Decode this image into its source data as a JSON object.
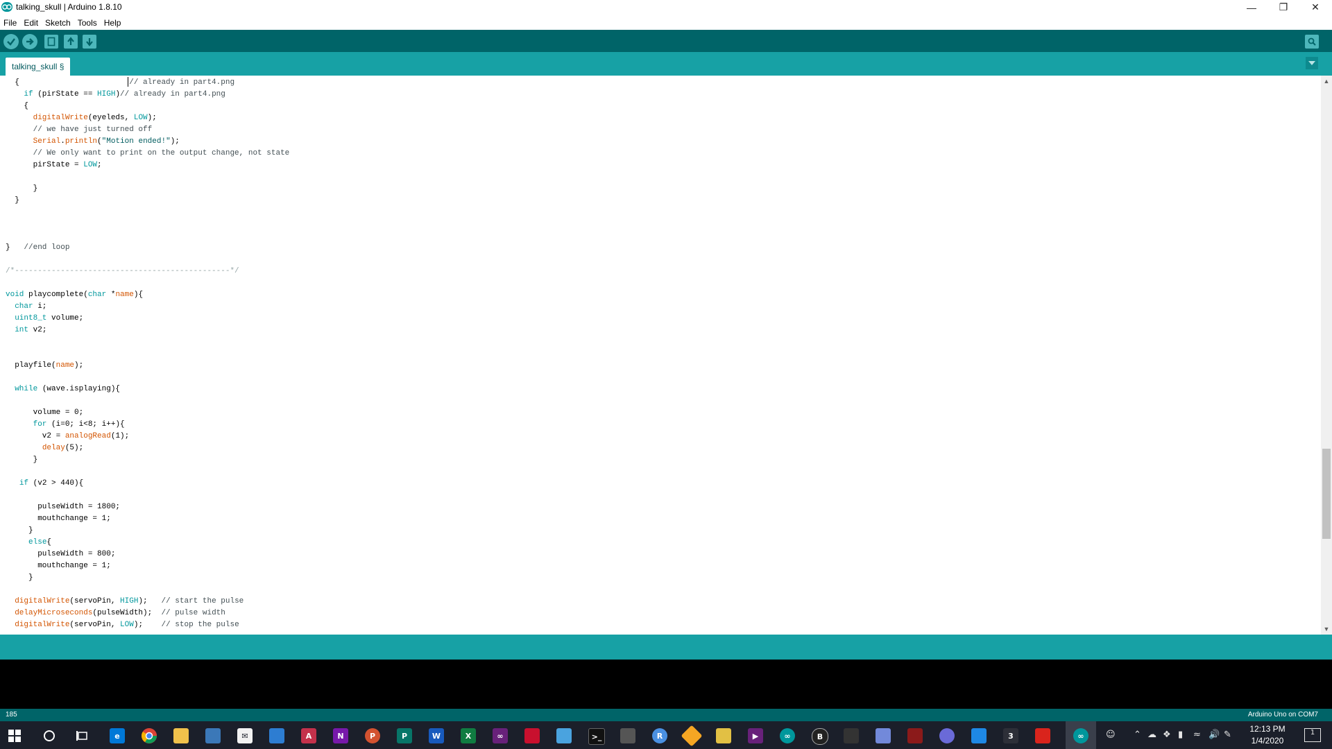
{
  "window": {
    "title": "talking_skull | Arduino 1.8.10",
    "controls": [
      "minimize-icon",
      "restore-icon",
      "close-icon"
    ]
  },
  "menu": [
    "File",
    "Edit",
    "Sketch",
    "Tools",
    "Help"
  ],
  "toolbar": {
    "buttons": [
      "verify-icon",
      "upload-icon",
      "new-icon",
      "open-icon",
      "save-icon",
      "serial-monitor-icon"
    ]
  },
  "tabs": [
    {
      "label": "talking_skull §",
      "active": true
    }
  ],
  "editor": {
    "line_count": 47
  },
  "status": {
    "line_number": "185",
    "board": "Arduino Uno on COM7"
  },
  "taskbar": {
    "clock_time": "12:13 PM",
    "clock_date": "1/4/2020",
    "notification_count": "1",
    "badge_count": "3"
  },
  "colors": {
    "toolbar": "#006468",
    "tabbar": "#17a1a5",
    "keyword": "#00979c",
    "function": "#d35400",
    "taskbar": "#1b1f2a"
  }
}
